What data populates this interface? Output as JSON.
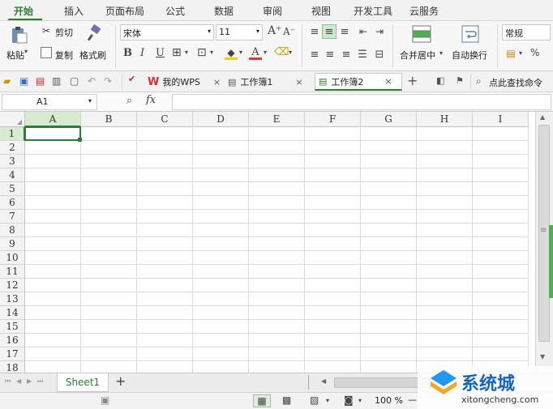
{
  "menubar": {
    "tabs": [
      "开始",
      "插入",
      "页面布局",
      "公式",
      "数据",
      "审阅",
      "视图",
      "开发工具",
      "云服务"
    ],
    "active": "开始"
  },
  "ribbon": {
    "paste_label": "粘贴",
    "cut_label": "剪切",
    "copy_label": "复制",
    "format_painter_label": "格式刷",
    "font_name": "宋体",
    "font_size": "11",
    "bold": "B",
    "italic": "I",
    "underline": "U",
    "merge_center_label": "合并居中",
    "wrap_text_label": "自动换行",
    "number_format": "常规",
    "percent_symbol": "%",
    "grow_font": "A⁺",
    "shrink_font": "A⁻",
    "font_color_letter": "A"
  },
  "quickbar": {
    "doc_tabs": [
      "我的WPS",
      "工作簿1",
      "工作簿2"
    ],
    "active_doc": "工作簿2",
    "close_glyph": "×",
    "new_tab_glyph": "+",
    "search_label": "点此查找命令"
  },
  "formulabar": {
    "cell_ref": "A1",
    "fx_label": "fx",
    "formula_value": ""
  },
  "grid": {
    "columns": [
      "A",
      "B",
      "C",
      "D",
      "E",
      "F",
      "G",
      "H",
      "I"
    ],
    "rows": [
      "1",
      "2",
      "3",
      "4",
      "5",
      "6",
      "7",
      "8",
      "9",
      "10",
      "11",
      "12",
      "13",
      "14",
      "15",
      "16",
      "17",
      "18"
    ],
    "selected_cell": "A1"
  },
  "sheetbar": {
    "sheets": [
      "Sheet1"
    ],
    "add_sheet_glyph": "+"
  },
  "statusbar": {
    "zoom": "100 %",
    "zoom_out": "—"
  },
  "watermark": {
    "brand_text": "系统城",
    "domain_text": "xitongcheng.com"
  },
  "colors": {
    "accent": "#2e7d32",
    "selection_fill": "#d9ead3",
    "side_tab": "#4caf50",
    "wps_red": "#d32f2f"
  }
}
